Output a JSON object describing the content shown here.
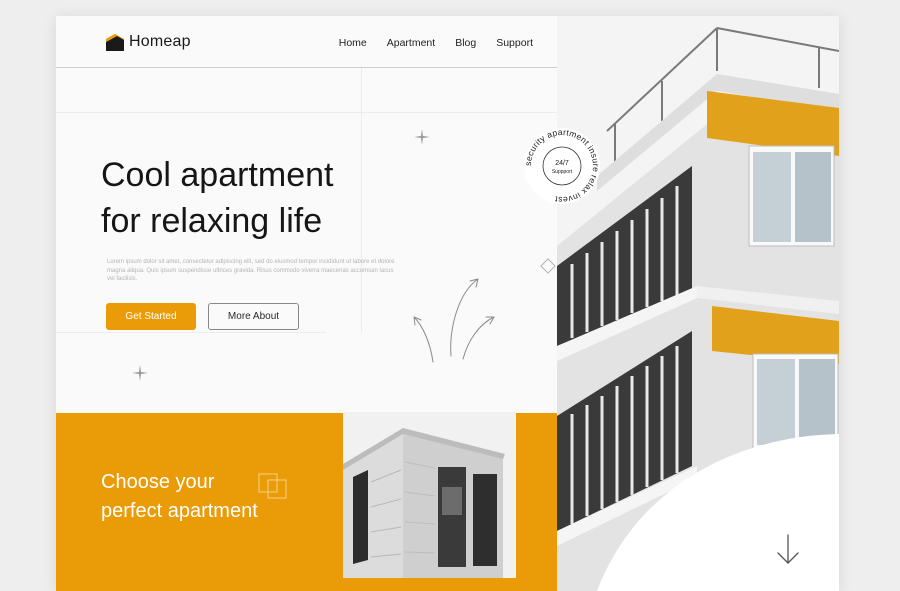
{
  "brand": {
    "name": "Homeap",
    "accent": "#e99c07"
  },
  "nav": {
    "items": [
      {
        "label": "Home"
      },
      {
        "label": "Apartment"
      },
      {
        "label": "Blog"
      },
      {
        "label": "Support"
      }
    ]
  },
  "hero": {
    "title_line1": "Cool apartment",
    "title_line2": "for relaxing life",
    "description": "Lorem ipsum dolor sit amet, consectetur adipiscing elit, sed do eiusmod tempor incididunt ut labore et dolore magna aliqua. Quis ipsum suspendisse ultrices gravida. Risus commodo viverra maecenas accumsan lacus vel facilisis.",
    "primary_button": "Get Started",
    "secondary_button": "More About"
  },
  "badge": {
    "center_line1": "24/7",
    "center_line2": "Suppport",
    "ring_text": "security apartment insure relax invest"
  },
  "section": {
    "title_line1": "Choose your",
    "title_line2": "perfect apartment"
  },
  "icons": {
    "logo": "house-roof-icon",
    "squares": "overlapping-squares-icon",
    "sparkle": "sparkle-icon",
    "down": "arrow-down-icon"
  }
}
